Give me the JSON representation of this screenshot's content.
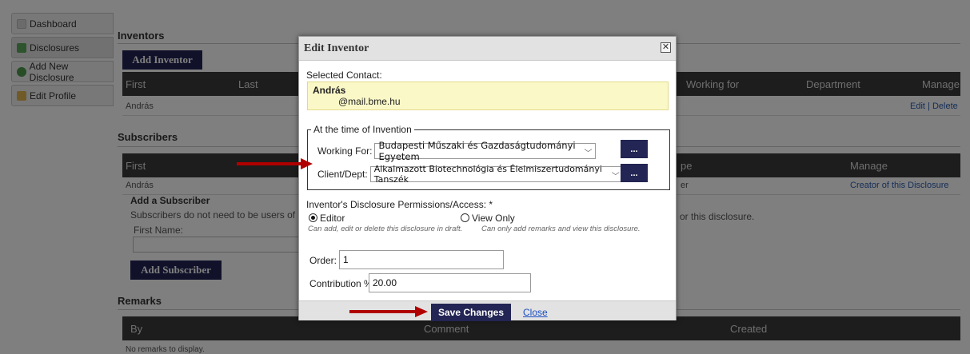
{
  "sidebar": {
    "items": [
      {
        "label": "Dashboard"
      },
      {
        "label": "Disclosures"
      },
      {
        "label": "Add New Disclosure"
      },
      {
        "label": "Edit Profile"
      }
    ]
  },
  "inventors": {
    "title": "Inventors",
    "add_button": "Add Inventor",
    "columns": [
      "First",
      "Last",
      "Working for",
      "Department",
      "Manage"
    ],
    "row": {
      "first": "András",
      "edit": "Edit",
      "sep": "|",
      "delete": "Delete"
    }
  },
  "subscribers": {
    "title": "Subscribers",
    "columns": [
      "First",
      "pe",
      "Manage"
    ],
    "row": {
      "first": "András",
      "type": "er",
      "manage": "Creator of this Disclosure"
    },
    "add_title": "Add a Subscriber",
    "note": "Subscribers do not need to be users of Invento",
    "note_tail": "or this disclosure.",
    "first_name_label": "First Name:",
    "add_button": "Add Subscriber"
  },
  "remarks": {
    "title": "Remarks",
    "columns": [
      "By",
      "Comment",
      "Created"
    ],
    "empty": "No remarks to display."
  },
  "modal": {
    "title": "Edit Inventor",
    "close_glyph": "✕",
    "selected_contact_label": "Selected Contact:",
    "contact_name": "András",
    "contact_email": "@mail.bme.hu",
    "fieldset_legend": "At the time of Invention",
    "working_for_label": "Working For:",
    "working_for_value": "Budapesti Műszaki és Gazdaságtudományi Egyetem",
    "client_dept_label": "Client/Dept:",
    "client_dept_value": "Alkalmazott Biotechnológia és Élelmiszertudományi Tanszék",
    "dots": "...",
    "permissions_label": "Inventor's Disclosure Permissions/Access: *",
    "editor_label": "Editor",
    "view_only_label": "View Only",
    "editor_note": "Can add, edit or delete this disclosure in draft.",
    "view_note": "Can only add remarks and view this disclosure.",
    "order_label": "Order: *",
    "order_value": "1",
    "contribution_label": "Contribution %:",
    "contribution_value": "20.00",
    "save_button": "Save Changes",
    "close_link": "Close"
  },
  "colors": {
    "accent_button": "#232554",
    "arrow": "#b00000",
    "contact_bg": "#fbf8c8"
  }
}
